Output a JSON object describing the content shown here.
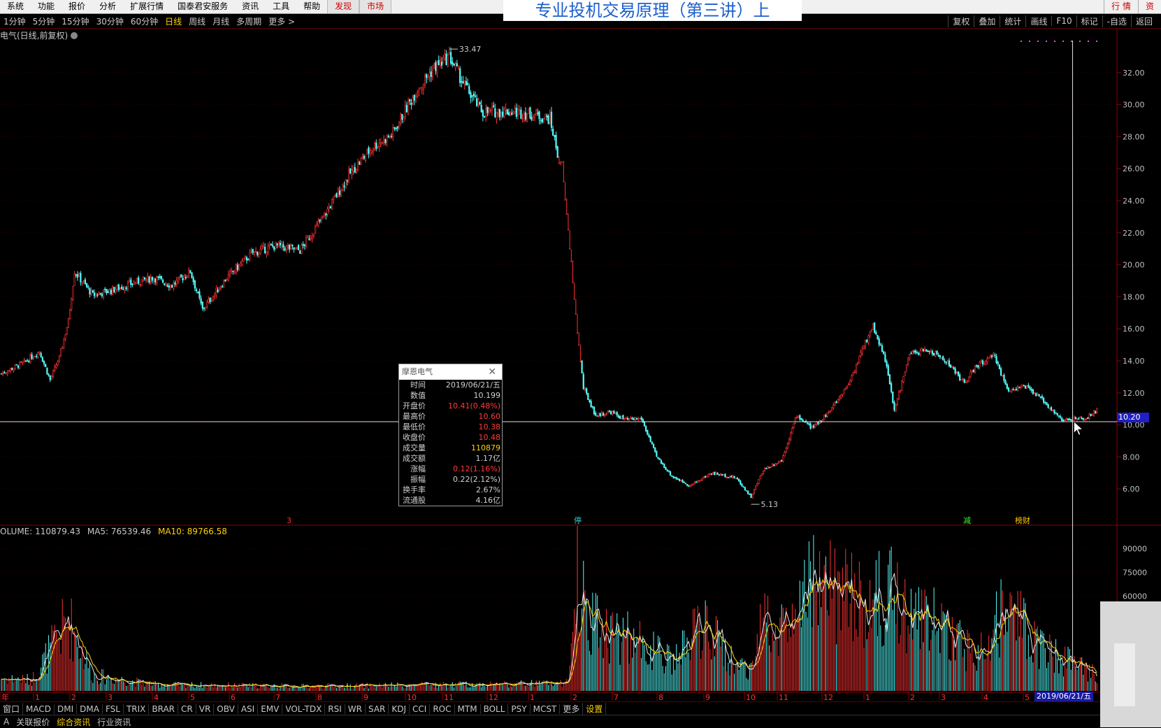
{
  "menu": [
    "系统",
    "功能",
    "报价",
    "分析",
    "扩展行情",
    "国泰君安服务",
    "资讯",
    "工具",
    "帮助"
  ],
  "menu_hot": [
    "发现",
    "市场"
  ],
  "right_tabs": [
    "行 情",
    "资"
  ],
  "banner_title": "专业投机交易原理（第三讲）上",
  "periods": [
    "1分钟",
    "5分钟",
    "15分钟",
    "30分钟",
    "60分钟",
    "日线",
    "周线",
    "月线",
    "多周期",
    "更多 >"
  ],
  "active_period": "日线",
  "tools": [
    "复权",
    "叠加",
    "统计",
    "画线",
    "F10",
    "标记",
    "-自选",
    "返回"
  ],
  "chart_title": "电气(日线,前复权)",
  "high_label": "33.47",
  "low_label": "5.13",
  "last_price": "10.20",
  "volume_header": {
    "vol": "OLUME: 110879.43",
    "ma5": "MA5: 76539.46",
    "ma10": "MA10: 89766.58"
  },
  "tooltip": {
    "title": "摩恩电气",
    "rows": [
      {
        "k": "时间",
        "v": "2019/06/21/五",
        "c": "plain"
      },
      {
        "k": "数值",
        "v": "10.199",
        "c": "plain"
      },
      {
        "k": "开盘价",
        "v": "10.41(0.48%)",
        "c": "red"
      },
      {
        "k": "最高价",
        "v": "10.60",
        "c": "red"
      },
      {
        "k": "最低价",
        "v": "10.38",
        "c": "red"
      },
      {
        "k": "收盘价",
        "v": "10.48",
        "c": "red"
      },
      {
        "k": "成交量",
        "v": "110879",
        "c": "yellow"
      },
      {
        "k": "成交额",
        "v": "1.17亿",
        "c": "plain"
      },
      {
        "k": "涨幅",
        "v": "0.12(1.16%)",
        "c": "red"
      },
      {
        "k": "振幅",
        "v": "0.22(2.12%)",
        "c": "plain"
      },
      {
        "k": "换手率",
        "v": "2.67%",
        "c": "plain"
      },
      {
        "k": "流通股",
        "v": "4.16亿",
        "c": "plain"
      }
    ]
  },
  "event_marks": [
    {
      "label": "3",
      "color": "#ff3030"
    },
    {
      "label": "停",
      "color": "#30d0d0"
    },
    {
      "label": "减",
      "color": "#30ff30"
    },
    {
      "label": "榜财",
      "color": "#ffcc00"
    }
  ],
  "x_labels": [
    "年",
    "1",
    "2",
    "3",
    "4",
    "5",
    "6",
    "7",
    "8",
    "9",
    "10",
    "11",
    "12",
    "1",
    "2",
    "7",
    "8",
    "9",
    "10",
    "11",
    "12",
    "1",
    "2",
    "3",
    "4",
    "5"
  ],
  "date_tag": "2019/06/21/五",
  "indicators": [
    "窗口",
    "MACD",
    "DMI",
    "DMA",
    "FSL",
    "TRIX",
    "BRAR",
    "CR",
    "VR",
    "OBV",
    "ASI",
    "EMV",
    "VOL-TDX",
    "RSI",
    "WR",
    "SAR",
    "KDJ",
    "CCI",
    "ROC",
    "MTM",
    "BOLL",
    "PSY",
    "MCST",
    "更多",
    "设置"
  ],
  "active_indicator": "设置",
  "bottom_tabs": [
    "A",
    "关联报价",
    "综合资讯",
    "行业资讯"
  ],
  "active_bottom_tab": "综合资讯",
  "chart_data": {
    "type": "candlestick",
    "price_axis": [
      6,
      8,
      10,
      12,
      14,
      16,
      18,
      20,
      22,
      24,
      26,
      28,
      30,
      32
    ],
    "price_axis_labels": [
      "6.00",
      "8.00",
      "10.00",
      "12.00",
      "14.00",
      "16.00",
      "18.00",
      "20.00",
      "22.00",
      "24.00",
      "26.00",
      "28.00",
      "30.00",
      "32.00"
    ],
    "ylim": [
      4,
      34
    ],
    "volume_axis": [
      60000,
      75000,
      90000
    ],
    "volume_axis_labels": [
      "60000",
      "75000",
      "90000"
    ],
    "vol_ylim": [
      0,
      100000
    ],
    "close_keypoints": [
      [
        0,
        13.2
      ],
      [
        15,
        13.9
      ],
      [
        25,
        14.6
      ],
      [
        32,
        12.8
      ],
      [
        38,
        14.2
      ],
      [
        44,
        16.5
      ],
      [
        48,
        19.6
      ],
      [
        60,
        18.1
      ],
      [
        72,
        18.4
      ],
      [
        88,
        18.9
      ],
      [
        100,
        19.2
      ],
      [
        112,
        18.7
      ],
      [
        124,
        19.6
      ],
      [
        132,
        17.2
      ],
      [
        148,
        19.2
      ],
      [
        164,
        20.7
      ],
      [
        180,
        21.2
      ],
      [
        196,
        20.9
      ],
      [
        212,
        23.1
      ],
      [
        228,
        25.6
      ],
      [
        244,
        27.4
      ],
      [
        256,
        28.1
      ],
      [
        272,
        30.8
      ],
      [
        284,
        32.3
      ],
      [
        294,
        33.0
      ],
      [
        304,
        31.2
      ],
      [
        316,
        29.5
      ],
      [
        332,
        29.6
      ],
      [
        348,
        29.4
      ],
      [
        360,
        29.1
      ],
      [
        366,
        26.5
      ],
      [
        368,
        26.5
      ],
      [
        370,
        24.3
      ],
      [
        372,
        22.0
      ],
      [
        374,
        20.0
      ],
      [
        376,
        17.8
      ],
      [
        378,
        15.8
      ],
      [
        380,
        14.0
      ],
      [
        382,
        12.3
      ],
      [
        390,
        10.6
      ],
      [
        400,
        10.8
      ],
      [
        410,
        10.3
      ],
      [
        420,
        10.4
      ],
      [
        430,
        8.0
      ],
      [
        440,
        6.8
      ],
      [
        452,
        6.2
      ],
      [
        466,
        7.0
      ],
      [
        482,
        6.7
      ],
      [
        492,
        5.5
      ],
      [
        500,
        7.2
      ],
      [
        512,
        7.8
      ],
      [
        522,
        10.6
      ],
      [
        532,
        9.8
      ],
      [
        544,
        10.9
      ],
      [
        556,
        12.6
      ],
      [
        566,
        14.9
      ],
      [
        572,
        16.2
      ],
      [
        580,
        14.1
      ],
      [
        586,
        10.9
      ],
      [
        596,
        14.4
      ],
      [
        608,
        14.7
      ],
      [
        620,
        14.0
      ],
      [
        632,
        12.6
      ],
      [
        640,
        13.7
      ],
      [
        652,
        14.3
      ],
      [
        660,
        12.2
      ],
      [
        672,
        12.4
      ],
      [
        684,
        11.5
      ],
      [
        696,
        10.3
      ],
      [
        712,
        10.4
      ],
      [
        720,
        11.0
      ]
    ],
    "volume_keypoints": [
      [
        0,
        8
      ],
      [
        20,
        7
      ],
      [
        44,
        45
      ],
      [
        60,
        10
      ],
      [
        100,
        4
      ],
      [
        200,
        3
      ],
      [
        300,
        4
      ],
      [
        372,
        5
      ],
      [
        378,
        70
      ],
      [
        390,
        42
      ],
      [
        420,
        30
      ],
      [
        440,
        18
      ],
      [
        460,
        42
      ],
      [
        480,
        18
      ],
      [
        494,
        15
      ],
      [
        500,
        50
      ],
      [
        520,
        40
      ],
      [
        530,
        65
      ],
      [
        560,
        60
      ],
      [
        570,
        50
      ],
      [
        580,
        62
      ],
      [
        600,
        48
      ],
      [
        620,
        42
      ],
      [
        640,
        20
      ],
      [
        660,
        55
      ],
      [
        680,
        30
      ],
      [
        700,
        18
      ],
      [
        720,
        10
      ]
    ],
    "max_high": 33.47,
    "min_low": 5.13
  }
}
